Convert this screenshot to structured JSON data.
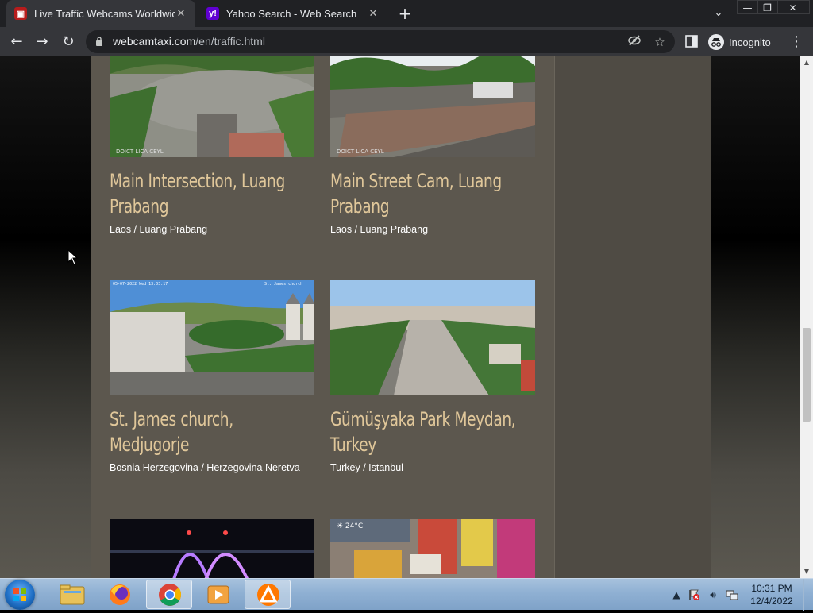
{
  "browser": {
    "tabs": [
      {
        "title": "Live Traffic Webcams Worldwide",
        "active": true
      },
      {
        "title": "Yahoo Search - Web Search",
        "active": false
      }
    ],
    "url_host": "webcamtaxi.com",
    "url_path": "/en/traffic.html",
    "incognito_label": "Incognito"
  },
  "webcams": [
    {
      "title": "Main Intersection, Luang Prabang",
      "location": "Laos / Luang Prabang"
    },
    {
      "title": "Main Street Cam, Luang Prabang",
      "location": "Laos / Luang Prabang"
    },
    {
      "title": "St. James church, Medjugorje",
      "location": "Bosnia Herzegovina / Herzegovina Neretva"
    },
    {
      "title": "Gümüşyaka Park Meydan, Turkey",
      "location": "Turkey / Istanbul"
    }
  ],
  "taskbar": {
    "time": "10:31 PM",
    "date": "12/4/2022",
    "apps": [
      "file-explorer",
      "firefox",
      "chrome",
      "media-player",
      "avast"
    ]
  }
}
